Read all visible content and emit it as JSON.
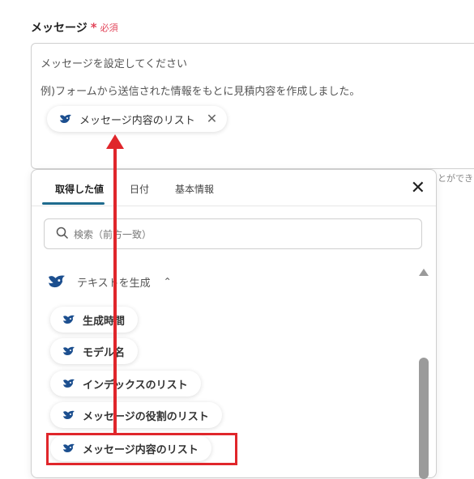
{
  "field": {
    "label": "メッセージ",
    "required_mark": "*",
    "required_text": "必須",
    "placeholder_line1": "メッセージを設定してください",
    "placeholder_line2": "例)フォームから送信された情報をもとに見積内容を作成しました。",
    "inserted_chip": "メッセージ内容のリスト"
  },
  "side_text": "とができま",
  "popup": {
    "tabs": [
      "取得した値",
      "日付",
      "基本情報"
    ],
    "active_tab": "取得した値",
    "search_placeholder": "検索（前方一致）",
    "group_label": "テキストを生成",
    "items": [
      "生成時間",
      "モデル名",
      "インデックスのリスト",
      "メッセージの役割のリスト",
      "メッセージ内容のリスト"
    ],
    "highlighted_item": "メッセージ内容のリスト"
  },
  "colors": {
    "accent": "#1f6b8e",
    "annotation": "#e0262b",
    "required": "#e2455a",
    "icon": "#1c4f8f"
  },
  "icons": [
    "whale-icon",
    "close-icon",
    "search-icon",
    "chevron-up-icon",
    "scroll-up-arrow-icon"
  ]
}
